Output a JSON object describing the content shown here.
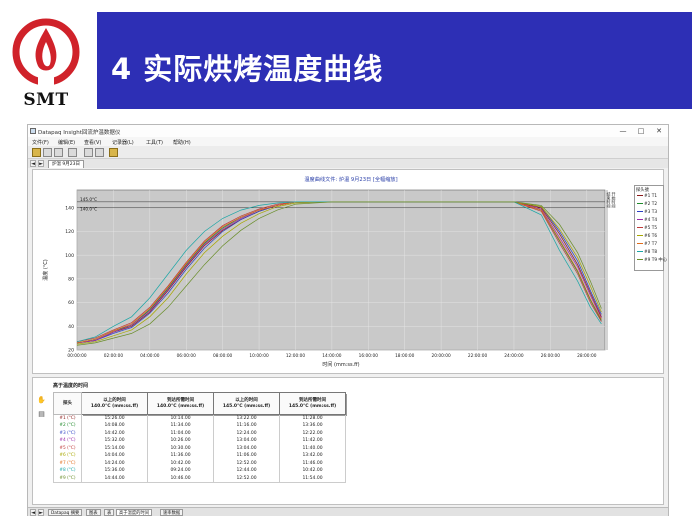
{
  "slide": {
    "title": "4  实际烘烤温度曲线",
    "logo_text": "SMT",
    "colors": {
      "banner": "#2d2fb5",
      "logo_red": "#d0222a"
    }
  },
  "window": {
    "title": "Datapaq Insight回流炉温数据仪",
    "minimize_icon": "—",
    "maximize_icon": "□",
    "close_icon": "✕",
    "menu": [
      "文件(F)",
      "编辑(E)",
      "查看(V)",
      "记录器(L)",
      "工具(T)",
      "帮助(H)"
    ],
    "toolbar_icons": [
      "open-folder-icon",
      "save-icon",
      "print-icon",
      "settings-icon",
      "logger-down-icon",
      "logger-up-icon",
      "probe-icon"
    ],
    "tab": "炉温 9月23日",
    "nav_prev": "◄",
    "nav_next": "►"
  },
  "chart_data": {
    "type": "line",
    "title": "温度曲线文件: 炉温 9月23日 [全幅缩放]",
    "xlabel": "时间 (mm:ss.ff)",
    "ylabel": "温度 (°C)",
    "ylim": [
      20,
      155
    ],
    "yticks": [
      20,
      40,
      60,
      80,
      100,
      120,
      140
    ],
    "xlim": [
      0,
      29
    ],
    "xticks_min": [
      0,
      2,
      4,
      6,
      8,
      10,
      12,
      14,
      16,
      18,
      20,
      22,
      24,
      26,
      28
    ],
    "xtick_labels": [
      "00:00:00",
      "02:00:00",
      "04:00:00",
      "06:00:00",
      "08:00:00",
      "10:00:00",
      "12:00:00",
      "14:00:00",
      "16:00:00",
      "18:00:00",
      "20:00:00",
      "22:00:00",
      "24:00:00",
      "26:00:00",
      "28:00:00"
    ],
    "grid": true,
    "background": "#c9c9c9",
    "reference_lines": [
      {
        "label": "145.0°C",
        "value": 145
      },
      {
        "label": "140.0°C",
        "value": 140
      }
    ],
    "right_markers": [
      "结束时间",
      "开始时间"
    ],
    "legend": {
      "title": "探头號",
      "placement": "right"
    },
    "series": [
      {
        "name": "#1 T1",
        "color": "#8b1a1a",
        "x": [
          0,
          1,
          2,
          3,
          4,
          5,
          6,
          7,
          8,
          9,
          10,
          11,
          12,
          14,
          18,
          22,
          24,
          25.5,
          26.5,
          27.5,
          28.2,
          28.8
        ],
        "y": [
          26,
          28,
          35,
          40,
          52,
          70,
          90,
          108,
          121,
          130,
          137,
          142,
          145,
          145,
          145,
          145,
          145,
          140,
          118,
          92,
          68,
          48
        ]
      },
      {
        "name": "#2 T2",
        "color": "#1f8a2a",
        "x": [
          0,
          1,
          2,
          3,
          4,
          5,
          6,
          7,
          8,
          9,
          10,
          11,
          12,
          14,
          18,
          22,
          24,
          25.5,
          26.5,
          27.5,
          28.2,
          28.8
        ],
        "y": [
          26,
          29,
          36,
          41,
          54,
          72,
          92,
          110,
          123,
          132,
          138,
          142,
          145,
          145,
          145,
          145,
          145,
          138,
          112,
          86,
          62,
          45
        ]
      },
      {
        "name": "#3 T3",
        "color": "#2a3fc4",
        "x": [
          0,
          1,
          2,
          3,
          4,
          5,
          6,
          7,
          8,
          9,
          10,
          11,
          12,
          14,
          18,
          22,
          24,
          25.5,
          26.5,
          27.5,
          28.2,
          28.8
        ],
        "y": [
          26,
          28,
          34,
          39,
          51,
          68,
          88,
          106,
          120,
          130,
          137,
          142,
          145,
          145,
          145,
          145,
          145,
          141,
          120,
          95,
          70,
          50
        ]
      },
      {
        "name": "#4 T4",
        "color": "#9a2aa8",
        "x": [
          0,
          1,
          2,
          3,
          4,
          5,
          6,
          7,
          8,
          9,
          10,
          11,
          12,
          14,
          18,
          22,
          24,
          25.5,
          26.5,
          27.5,
          28.2,
          28.8
        ],
        "y": [
          26,
          28,
          35,
          41,
          53,
          71,
          91,
          109,
          122,
          131,
          138,
          142,
          145,
          145,
          145,
          145,
          145,
          139,
          115,
          90,
          66,
          47
        ]
      },
      {
        "name": "#5 T5",
        "color": "#c03a3a",
        "x": [
          0,
          1,
          2,
          3,
          4,
          5,
          6,
          7,
          8,
          9,
          10,
          11,
          12,
          14,
          18,
          22,
          24,
          25.5,
          26.5,
          27.5,
          28.2,
          28.8
        ],
        "y": [
          27,
          30,
          37,
          43,
          56,
          74,
          94,
          112,
          125,
          133,
          139,
          143,
          145,
          145,
          145,
          145,
          145,
          137,
          110,
          84,
          60,
          44
        ]
      },
      {
        "name": "#6 T6",
        "color": "#a8a800",
        "x": [
          0,
          1,
          2,
          3,
          4,
          5,
          6,
          7,
          8,
          9,
          10,
          11,
          12,
          14,
          18,
          22,
          24,
          25.5,
          26.5,
          27.5,
          28.2,
          28.8
        ],
        "y": [
          25,
          27,
          32,
          37,
          48,
          64,
          84,
          102,
          116,
          127,
          135,
          141,
          144,
          145,
          145,
          145,
          145,
          141,
          122,
          98,
          74,
          52
        ]
      },
      {
        "name": "#7 T7",
        "color": "#e06c1a",
        "x": [
          0,
          1,
          2,
          3,
          4,
          5,
          6,
          7,
          8,
          9,
          10,
          11,
          12,
          14,
          18,
          22,
          24,
          25.5,
          26.5,
          27.5,
          28.2,
          28.8
        ],
        "y": [
          26,
          29,
          36,
          42,
          55,
          73,
          93,
          111,
          124,
          132,
          138,
          142,
          145,
          145,
          145,
          145,
          145,
          138,
          113,
          87,
          63,
          46
        ]
      },
      {
        "name": "#8 T8",
        "color": "#1aa6a6",
        "x": [
          0,
          1,
          2,
          3,
          4,
          5,
          6,
          7,
          8,
          9,
          10,
          11,
          12,
          14,
          18,
          22,
          24,
          25.5,
          26.5,
          27.5,
          28.2,
          28.8
        ],
        "y": [
          27,
          31,
          40,
          48,
          64,
          84,
          104,
          120,
          131,
          138,
          142,
          144,
          145,
          145,
          145,
          145,
          145,
          134,
          104,
          78,
          56,
          42
        ]
      },
      {
        "name": "#9 T9 中心",
        "color": "#6a8e2a",
        "x": [
          0,
          1,
          2,
          3,
          4,
          5,
          6,
          7,
          8,
          9,
          10,
          11,
          12,
          14,
          18,
          22,
          24,
          25.5,
          26.5,
          27.5,
          28.2,
          28.8
        ],
        "y": [
          24,
          26,
          30,
          34,
          42,
          56,
          74,
          92,
          108,
          121,
          131,
          138,
          143,
          145,
          145,
          145,
          145,
          142,
          126,
          102,
          78,
          55
        ]
      }
    ]
  },
  "bottom": {
    "title": "高于温度的时间",
    "side_icons": [
      "hand-icon",
      "document-icon"
    ],
    "table": {
      "headers": [
        "探头",
        "以上的时间\n140.0°C (mm:ss.ff)",
        "到达所需时间\n140.0°C (mm:ss.ff)",
        "以上的时间\n145.0°C (mm:ss.ff)",
        "到达所需时间\n145.0°C (mm:ss.ff)"
      ],
      "rows": [
        [
          "#1 (°C)",
          "15:26.00",
          "10:14.00",
          "13:22.00",
          "11:28.00"
        ],
        [
          "#2 (°C)",
          "14:08.00",
          "11:34.00",
          "11:16.00",
          "13:36.00"
        ],
        [
          "#3 (°C)",
          "14:42.00",
          "11:04.00",
          "12:24.00",
          "12:22.00"
        ],
        [
          "#4 (°C)",
          "15:32.00",
          "10:26.00",
          "13:04.00",
          "11:42.00"
        ],
        [
          "#5 (°C)",
          "15:14.00",
          "10:30.00",
          "13:04.00",
          "11:40.00"
        ],
        [
          "#6 (°C)",
          "14:04.00",
          "11:36.00",
          "11:06.00",
          "13:42.00"
        ],
        [
          "#7 (°C)",
          "14:24.00",
          "10:42.00",
          "12:52.00",
          "11:46.00"
        ],
        [
          "#8 (°C)",
          "15:36.00",
          "09:24.00",
          "12:44.00",
          "10:42.00"
        ],
        [
          "#9 (°C)",
          "14:44.00",
          "10:46.00",
          "12:52.00",
          "11:54.00"
        ]
      ]
    },
    "status_tabs": [
      "Datapaq 摘要",
      "图表",
      "表",
      "高于温度的时间",
      "速率数据"
    ]
  }
}
